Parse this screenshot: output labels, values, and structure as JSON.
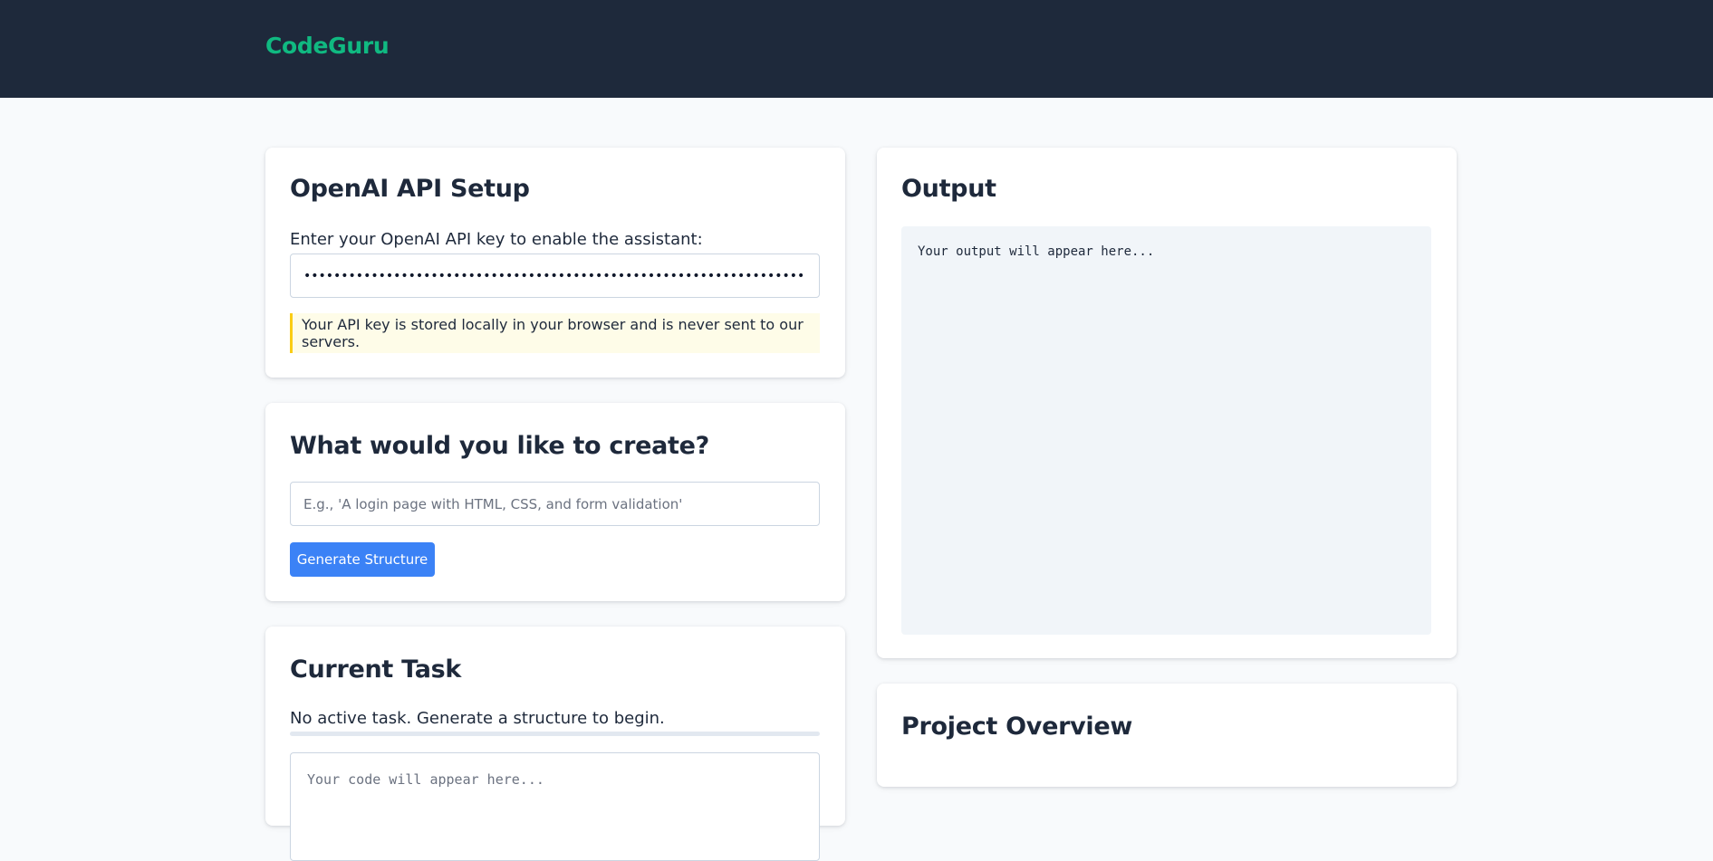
{
  "header": {
    "brand": "CodeGuru",
    "brand_color": "#10b981",
    "background": "#1e293b"
  },
  "setup": {
    "title": "OpenAI API Setup",
    "label": "Enter your OpenAI API key to enable the assistant:",
    "api_key_value": "sk-proj-xxxxxxxxxxxxxxxxxxxxxxxxxxxxxxxxxxxxxxxxxxxxxxxxxxxxxxxxxxxxxxxxxxxxxxxxxx",
    "notice": "Your API key is stored locally in your browser and is never sent to our servers."
  },
  "create": {
    "title": "What would you like to create?",
    "placeholder": "E.g., 'A login page with HTML, CSS, and form validation'",
    "button_label": "Generate Structure",
    "button_color": "#3b82f6"
  },
  "task": {
    "title": "Current Task",
    "status": "No active task. Generate a structure to begin.",
    "progress": 0,
    "code_placeholder": "Your code will appear here..."
  },
  "output": {
    "title": "Output",
    "placeholder_text": "Your output will appear here..."
  },
  "overview": {
    "title": "Project Overview"
  }
}
